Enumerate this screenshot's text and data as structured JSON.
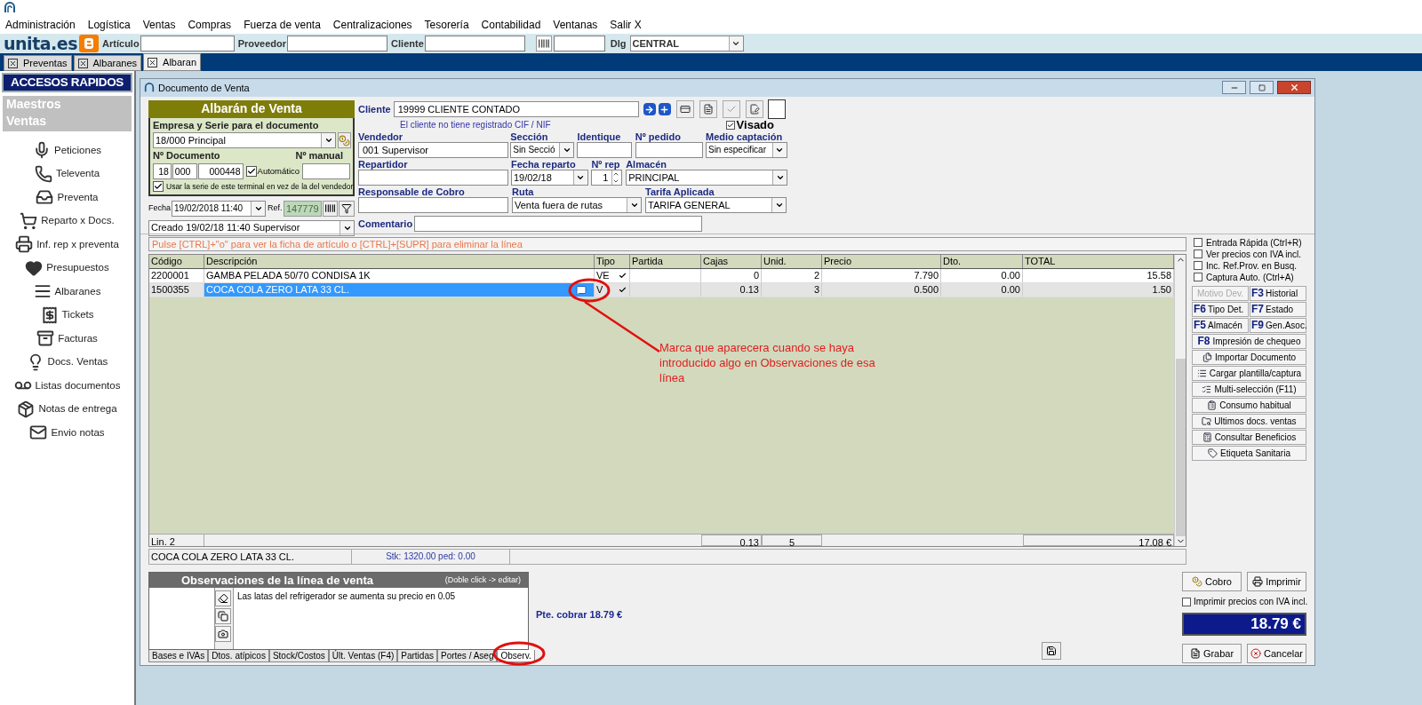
{
  "menu": [
    "Administración",
    "Logística",
    "Ventas",
    "Compras",
    "Fuerza de venta",
    "Centralizaciones",
    "Tesorería",
    "Contabilidad",
    "Ventanas",
    "Salir X"
  ],
  "toolbar": {
    "brand": "unita.es",
    "fields": [
      {
        "label": "Artículo"
      },
      {
        "label": "Proveedor"
      },
      {
        "label": "Cliente"
      }
    ],
    "dlg_label": "Dlg",
    "dlg_value": "CENTRAL"
  },
  "tabs": [
    {
      "label": "Preventas",
      "selected": false
    },
    {
      "label": "Albaranes",
      "selected": false
    },
    {
      "label": "Albaran",
      "selected": true
    }
  ],
  "sidebar": {
    "title": "ACCESOS RAPIDOS",
    "groups": [
      "Maestros",
      "Ventas"
    ],
    "items": [
      "Peticiones",
      "Televenta",
      "Preventa",
      "Reparto x Docs.",
      "Inf. rep x preventa",
      "Presupuestos",
      "Albaranes",
      "Tickets",
      "Facturas",
      "Docs. Ventas",
      "Listas documentos",
      "Notas de entrega",
      "Envio notas"
    ]
  },
  "window": {
    "title": "Documento de Venta"
  },
  "doc_panel": {
    "title": "Albarán de Venta",
    "serie_label": "Empresa y Serie para el documento",
    "serie_value": "18/000 Principal",
    "doc_label": "Nº Documento",
    "manual_label": "Nº manual",
    "doc_parts": [
      "18",
      "000",
      "000448"
    ],
    "auto": {
      "label": "Automático",
      "checked": true
    },
    "terminal": {
      "label": "Usar la serie de este terminal en vez de la del vendedor",
      "checked": true
    },
    "fecha_label": "Fecha",
    "fecha_value": "19/02/2018 11:40",
    "ref_label": "Ref.",
    "ref_value": "147779",
    "created": "Creado 19/02/18 11:40 Supervisor"
  },
  "client": {
    "label": "Cliente",
    "value": "19999 CLIENTE CONTADO",
    "notice": "El cliente no tiene registrado CIF / NIF",
    "visado": {
      "label": "Visado",
      "checked": true
    }
  },
  "form_rows": [
    [
      {
        "label": "Vendedor",
        "kind": "input",
        "value": "001 Supervisor"
      },
      {
        "label": "Sección",
        "kind": "select",
        "value": "Sin Secció"
      },
      {
        "label": "Identique",
        "kind": "input"
      },
      {
        "label": "Nº pedido",
        "kind": "input"
      },
      {
        "label": "Medio captación",
        "kind": "select",
        "value": "Sin especificar"
      }
    ],
    [
      {
        "label": "Repartidor",
        "kind": "input"
      },
      {
        "label": "Fecha reparto",
        "kind": "select",
        "value": "19/02/18"
      },
      {
        "label": "Nº rep",
        "kind": "spinner",
        "value": "1"
      },
      {
        "label": "Almacén",
        "kind": "select",
        "value": "PRINCIPAL"
      }
    ],
    [
      {
        "label": "Responsable de Cobro",
        "kind": "input"
      },
      {
        "label": "Ruta",
        "kind": "select",
        "value": "Venta fuera de rutas"
      },
      {
        "label": "Tarifa Aplicada",
        "kind": "select",
        "value": "TARIFA GENERAL"
      }
    ]
  ],
  "comment_label": "Comentario",
  "hint": "Pulse [CTRL]+\"o\" para ver la ficha de artículo o [CTRL]+[SUPR] para eliminar la línea",
  "table": {
    "columns": [
      "Código",
      "Descripción",
      "Tipo",
      "Partida",
      "Cajas",
      "Unid.",
      "Precio",
      "Dto.",
      "TOTAL"
    ],
    "rows": [
      {
        "codigo": "2200001",
        "descripcion": "GAMBA PELADA 50/70 CONDISA 1K",
        "tipo": "VE",
        "cajas": "0",
        "unid": "2",
        "precio": "7.790",
        "dto": "0.00",
        "total": "15.58",
        "selected": false,
        "note": false
      },
      {
        "codigo": "1500355",
        "descripcion": "COCA COLA ZERO LATA 33 CL.",
        "tipo": "V",
        "cajas": "0.13",
        "unid": "3",
        "precio": "0.500",
        "dto": "0.00",
        "total": "1.50",
        "selected": true,
        "note": true
      }
    ],
    "footer": {
      "lines": "Lin. 2",
      "cajas": "0.13",
      "unid": "5",
      "total": "17.08 €"
    }
  },
  "detail": {
    "article": "COCA COLA ZERO LATA 33 CL.",
    "stock": "Stk: 1320.00 ped: 0.00"
  },
  "options": [
    {
      "label": "Entrada Rápida (Ctrl+R)",
      "checked": false
    },
    {
      "label": "Ver precios con IVA incl.",
      "checked": false
    },
    {
      "label": "Inc. Ref.Prov. en Busq.",
      "checked": false
    },
    {
      "label": "Captura Auto. (Ctrl+A)",
      "checked": false
    }
  ],
  "key_buttons": [
    {
      "label": "Motivo Dev.",
      "disabled": true
    },
    {
      "key": "F3",
      "label": "Historial",
      "disabled": false
    },
    {
      "key": "F6",
      "label": "Tipo Det.",
      "disabled": false
    },
    {
      "key": "F7",
      "label": "Estado",
      "disabled": false
    },
    {
      "key": "F5",
      "label": "Almacén",
      "disabled": false
    },
    {
      "key": "F9",
      "label": "Gen.Asoc.",
      "disabled": false
    }
  ],
  "wide_buttons": [
    {
      "kind": "fkey",
      "key": "F8",
      "label": "Impresión de chequeo"
    },
    {
      "kind": "icon",
      "label": "Importar Documento"
    },
    {
      "kind": "icon",
      "label": "Cargar plantilla/captura"
    },
    {
      "kind": "icon",
      "label": "Multi-selección (F11)"
    },
    {
      "kind": "icon",
      "label": "Consumo habitual"
    },
    {
      "kind": "icon",
      "label": "Ultimos docs. ventas"
    },
    {
      "kind": "icon",
      "label": "Consultar Beneficios"
    },
    {
      "kind": "icon",
      "label": "Etiqueta Sanitaria"
    }
  ],
  "observations": {
    "title": "Observaciones de la línea de venta",
    "hint": "(Doble click -> editar)",
    "text": "Las latas del refrigerador se aumenta su precio en 0.05"
  },
  "bottom_tabs": [
    {
      "label": "Bases e IVAs",
      "selected": false
    },
    {
      "label": "Dtos. atípicos",
      "selected": false
    },
    {
      "label": "Stock/Costos",
      "selected": false
    },
    {
      "label": "Últ. Ventas (F4)",
      "selected": false
    },
    {
      "label": "Partidas",
      "selected": false
    },
    {
      "label": "Portes / Aseg",
      "selected": false
    },
    {
      "label": "Observ.",
      "selected": true
    }
  ],
  "pending": "Pte. cobrar 18.79 €",
  "actions": {
    "cobro": "Cobro",
    "imprimir": "Imprimir",
    "iva_check": {
      "label": "Imprimir precios con IVA incl.",
      "checked": false
    },
    "total": "18.79 €",
    "grabar": "Grabar",
    "cancelar": "Cancelar"
  },
  "annotation": {
    "text": "Marca que aparecera cuando se haya introducido algo en Observaciones de esa línea"
  }
}
